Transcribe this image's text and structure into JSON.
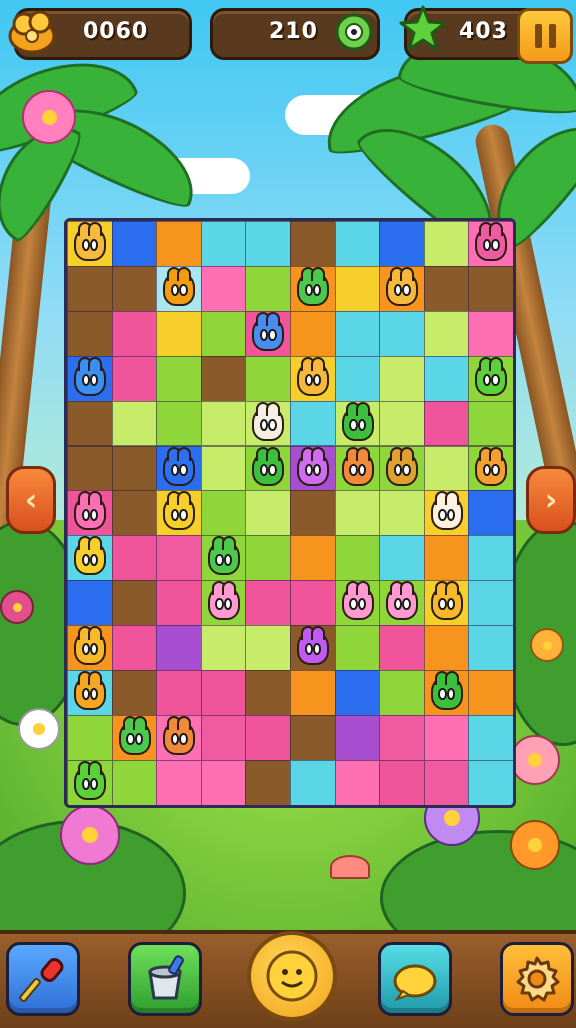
{
  "hud": {
    "coins": {
      "value": "0060",
      "icon": "coin-pile-icon"
    },
    "moves": {
      "value": "210",
      "icon": "green-creature-icon"
    },
    "stars": {
      "value": "403",
      "icon": "star-icon"
    },
    "pause_icon": "pause-icon"
  },
  "navigation": {
    "left_icon": "chevron-left-icon",
    "right_icon": "chevron-right-icon",
    "left_glyph": "‹",
    "right_glyph": "›"
  },
  "board": {
    "cols": 10,
    "rows": 13
  },
  "toolbar": {
    "items": [
      {
        "name": "screwdriver-tool-button",
        "icon": "screwdriver-icon",
        "color": "#3d8df0"
      },
      {
        "name": "bucket-tool-button",
        "icon": "bucket-icon",
        "color": "#3cbf3c"
      },
      {
        "name": "main-action-button",
        "icon": "smiley-icon",
        "color": "#f7b82a"
      },
      {
        "name": "lemon-tool-button",
        "icon": "lemon-icon",
        "color": "#34c2c9"
      },
      {
        "name": "settings-button",
        "icon": "gear-icon",
        "color": "#f6a623"
      }
    ]
  },
  "colors": {
    "hud_panel": "#5a3a1e",
    "pink": "#f0549b",
    "cyan": "#5ad6e6",
    "orange": "#f7941d",
    "green": "#8fd63a",
    "blue": "#2b6ff0",
    "brown": "#8b5a2b",
    "purple": "#a84fd1"
  }
}
